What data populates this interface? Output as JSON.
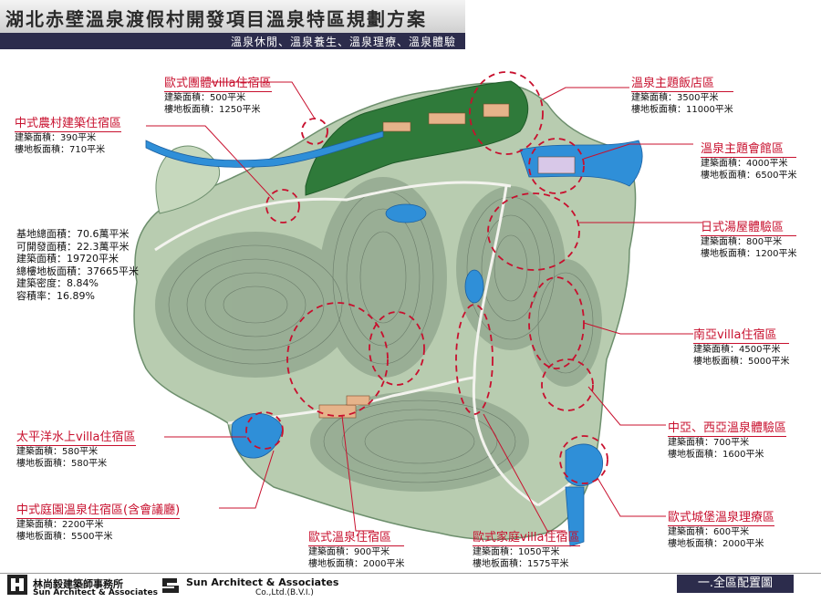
{
  "title": "湖北赤壁溫泉渡假村開發項目溫泉特區規劃方案",
  "subtitle": "溫泉休閒、溫泉養生、溫泉理療、溫泉體驗",
  "stats": [
    "基地總面積：70.6萬平米",
    "可開發面積：22.3萬平米",
    "建築面積：19720平米",
    "總樓地板面積：37665平米",
    "建築密度：8.84%",
    "容積率：16.89%"
  ],
  "zones": [
    {
      "name": "歐式團體villa住宿區",
      "lines": [
        "建築面積：500平米",
        "樓地板面積：1250平米"
      ]
    },
    {
      "name": "中式農村建築住宿區",
      "lines": [
        "建築面積：390平米",
        "樓地板面積：710平米"
      ]
    },
    {
      "name": "溫泉主題飯店區",
      "lines": [
        "建築面積：3500平米",
        "樓地板面積：11000平米"
      ]
    },
    {
      "name": "溫泉主題會館區",
      "lines": [
        "建築面積：4000平米",
        "樓地板面積：6500平米"
      ]
    },
    {
      "name": "日式湯屋體驗區",
      "lines": [
        "建築面積：800平米",
        "樓地板面積：1200平米"
      ]
    },
    {
      "name": "南亞villa住宿區",
      "lines": [
        "建築面積：4500平米",
        "樓地板面積：5000平米"
      ]
    },
    {
      "name": "中亞、西亞溫泉體驗區",
      "lines": [
        "建築面積：700平米",
        "樓地板面積：1600平米"
      ]
    },
    {
      "name": "太平洋水上villa住宿區",
      "lines": [
        "建築面積：580平米",
        "樓地板面積：580平米"
      ]
    },
    {
      "name": "中式庭園溫泉住宿區(含會議廳)",
      "lines": [
        "建築面積：2200平米",
        "樓地板面積：5500平米"
      ]
    },
    {
      "name": "歐式溫泉住宿區",
      "lines": [
        "建築面積：900平米",
        "樓地板面積：2000平米"
      ]
    },
    {
      "name": "歐式家庭villa住宿區",
      "lines": [
        "建築面積：1050平米",
        "樓地板面積：1575平米"
      ]
    },
    {
      "name": "歐式城堡溫泉理療區",
      "lines": [
        "建築面積：600平米",
        "樓地板面積：2000平米"
      ]
    }
  ],
  "footer": {
    "company_cn": "林尚毅建築師事務所",
    "company_en": "Sun Architect & Associates",
    "company2": "Sun Architect & Associates",
    "company2_sub": "Co.,Ltd.(B.V.I.)",
    "drawing_title": "一.全區配置圖"
  },
  "colors": {
    "label_red": "#c8102e",
    "title_bar_dark": "#2c2c4c",
    "forest_green": "#2f7a3a",
    "water_blue": "#2f8fd8"
  }
}
